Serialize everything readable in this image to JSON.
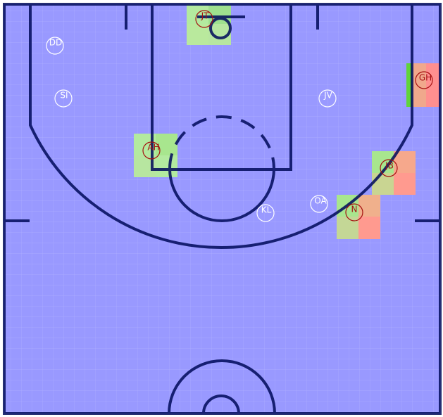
{
  "colors": {
    "court_fill": "#9999ff",
    "court_lines": "#000a5a",
    "grid_lines": "#b4b4ff",
    "player_ring_offense": "#ffffff",
    "player_ring_defense": "#a50f0f",
    "zone_green": "#9ee08e",
    "zone_red": "#ff8f8f"
  },
  "players": [
    {
      "id": "p-dd",
      "label": "DD",
      "team": "offense"
    },
    {
      "id": "p-si",
      "label": "SI",
      "team": "offense"
    },
    {
      "id": "p-jv",
      "label": "JV",
      "team": "offense"
    },
    {
      "id": "p-kl",
      "label": "KL",
      "team": "offense"
    },
    {
      "id": "p-oa",
      "label": "OA",
      "team": "offense"
    },
    {
      "id": "p-jt",
      "label": "JT",
      "team": "defense"
    },
    {
      "id": "p-gh",
      "label": "GH",
      "team": "defense"
    },
    {
      "id": "p-ah",
      "label": "AH",
      "team": "defense"
    },
    {
      "id": "p-jb",
      "label": "JB",
      "team": "defense"
    },
    {
      "id": "p-nl",
      "label": "N",
      "team": "defense"
    }
  ]
}
